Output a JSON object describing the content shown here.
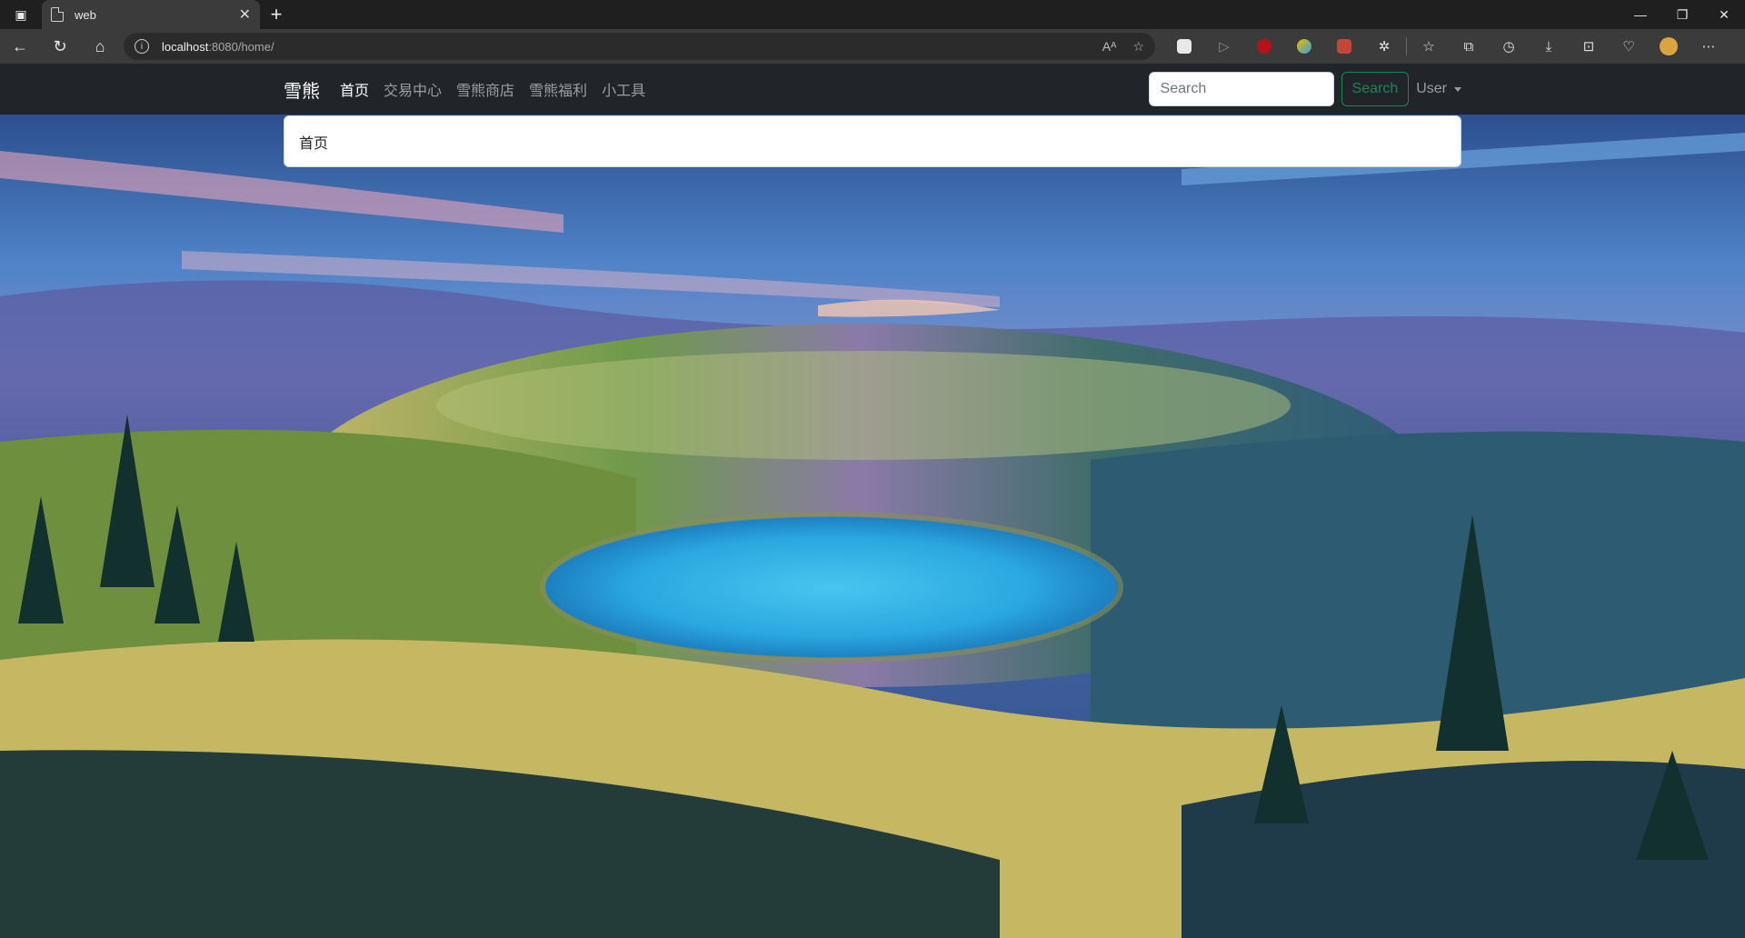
{
  "browser": {
    "tab_title": "web",
    "url_host": "localhost",
    "url_rest": ":8080/home/"
  },
  "navbar": {
    "brand": "雪熊",
    "links": [
      "首页",
      "交易中心",
      "雪熊商店",
      "雪熊福利",
      "小工具"
    ],
    "active_index": 0,
    "search_placeholder": "Search",
    "search_button": "Search",
    "user_menu": "User"
  },
  "card": {
    "body": "首页"
  },
  "colors": {
    "navbar_bg": "#212529",
    "search_button": "#198754"
  }
}
